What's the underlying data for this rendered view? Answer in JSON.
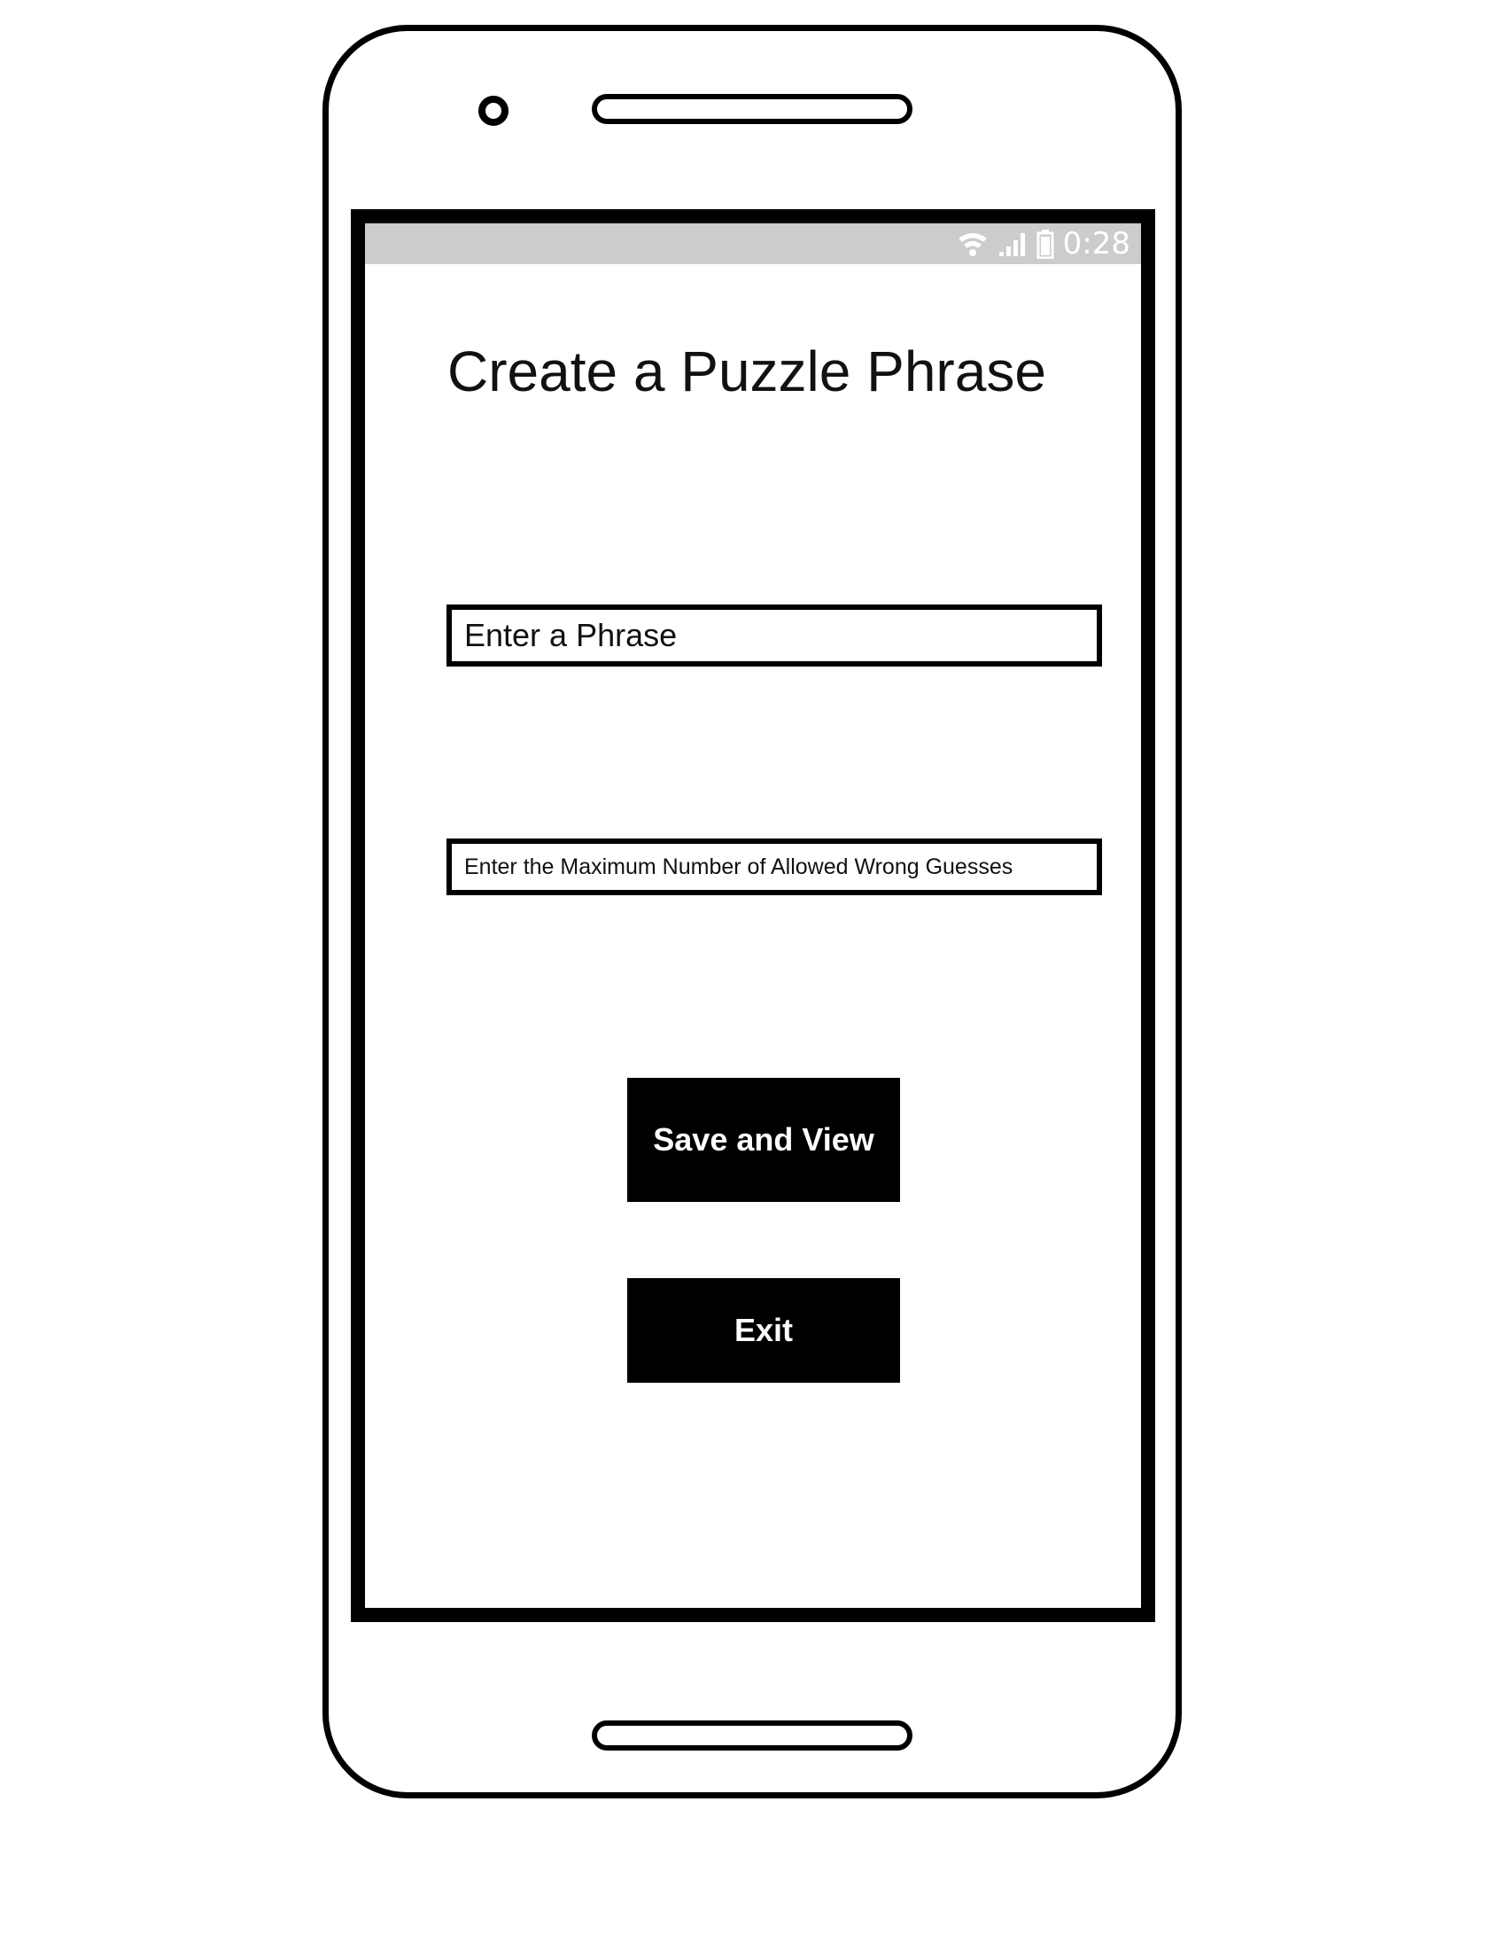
{
  "status_bar": {
    "time": "0:28",
    "icons": [
      "wifi-icon",
      "signal-icon",
      "battery-icon"
    ]
  },
  "screen": {
    "title": "Create a Puzzle Phrase",
    "phrase_input": {
      "placeholder": "Enter a Phrase",
      "value": ""
    },
    "max_guesses_input": {
      "placeholder": "Enter the Maximum Number of Allowed Wrong Guesses",
      "value": ""
    },
    "buttons": {
      "save_and_view": "Save and View",
      "exit": "Exit"
    }
  },
  "colors": {
    "status_bar_bg": "#cccccc",
    "frame": "#000000",
    "button_bg": "#000000",
    "button_text": "#ffffff"
  }
}
